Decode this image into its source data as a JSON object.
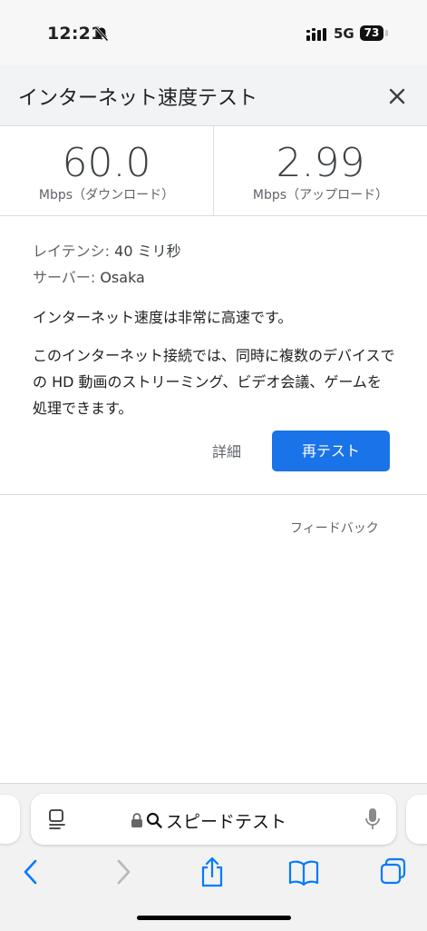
{
  "status": {
    "time": "12:21",
    "network": "5G",
    "battery": "73"
  },
  "header": {
    "title": "インターネット速度テスト"
  },
  "results": {
    "download_value": "60.0",
    "download_unit": "Mbps（ダウンロード）",
    "upload_value": "2.99",
    "upload_unit": "Mbps（アップロード）"
  },
  "details": {
    "latency_label": "レイテンシ:",
    "latency_value": "40 ミリ秒",
    "server_label": "サーバー:",
    "server_value": "Osaka",
    "summary": "インターネット速度は非常に高速です。",
    "description": "このインターネット接続では、同時に複数のデバイスでの HD 動画のストリーミング、ビデオ会議、ゲームを処理できます。"
  },
  "actions": {
    "details_label": "詳細",
    "retest_label": "再テスト",
    "feedback_label": "フィードバック"
  },
  "browser": {
    "url": "スピードテスト"
  },
  "colors": {
    "accent": "#1a73e8",
    "ios_blue": "#007aff"
  }
}
